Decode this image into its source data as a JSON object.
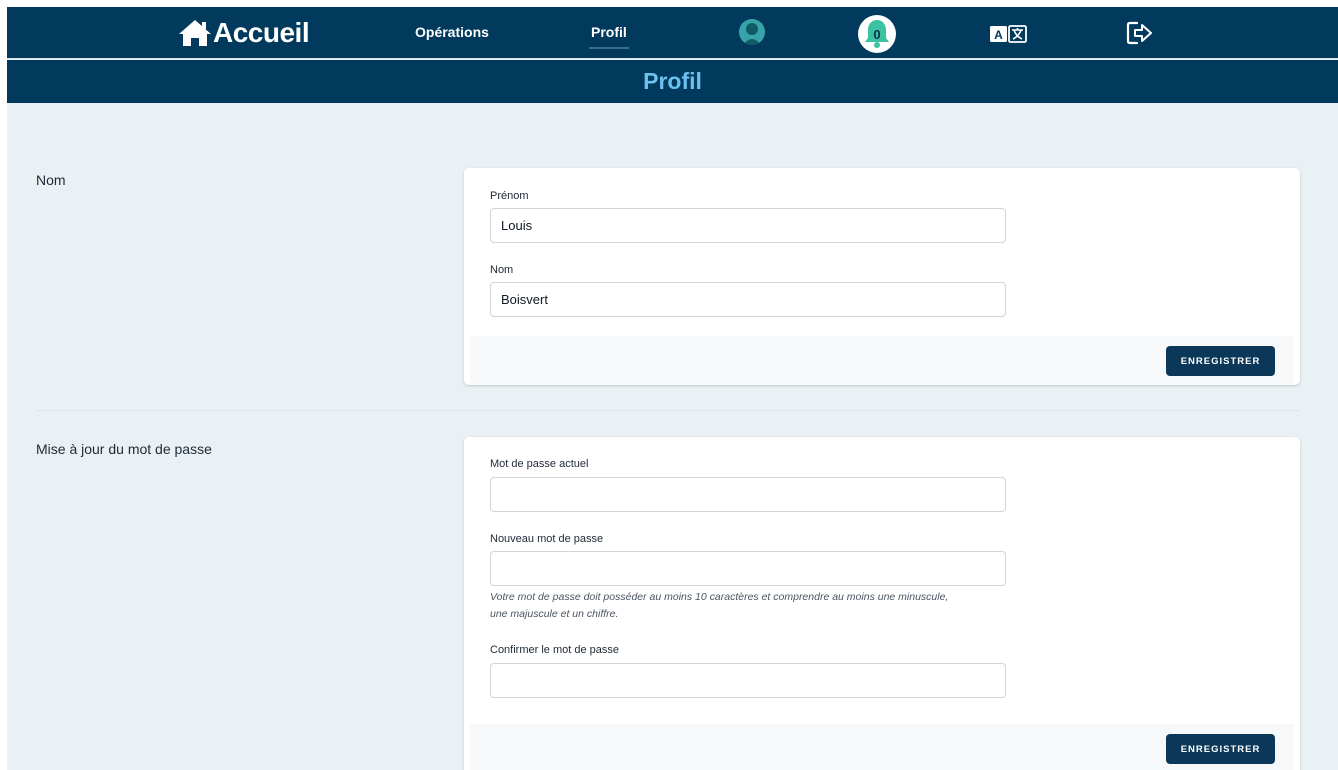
{
  "nav": {
    "brand": "Accueil",
    "operations": "Opérations",
    "profil": "Profil",
    "notification_count": "0",
    "translate_icon": "translate-icon",
    "logout_icon": "logout-icon"
  },
  "page": {
    "title": "Profil"
  },
  "name_section": {
    "label": "Nom",
    "first_name_label": "Prénom",
    "first_name_value": "Louis",
    "last_name_label": "Nom",
    "last_name_value": "Boisvert",
    "save_label": "ENREGISTRER"
  },
  "password_section": {
    "label": "Mise à jour du mot de passe",
    "current_label": "Mot de passe actuel",
    "current_value": "",
    "new_label": "Nouveau mot de passe",
    "new_value": "",
    "hint_line1": "Votre mot de passe doit posséder au moins 10 caractères et comprendre au moins une minuscule,",
    "hint_line2": "une majuscule et un chiffre.",
    "confirm_label": "Confirmer le mot de passe",
    "confirm_value": "",
    "save_label": "ENREGISTRER"
  },
  "colors": {
    "nav_bg": "#013a5c",
    "title": "#6cc2ee",
    "page_bg": "#eaf1f5",
    "button": "#0b3858"
  }
}
